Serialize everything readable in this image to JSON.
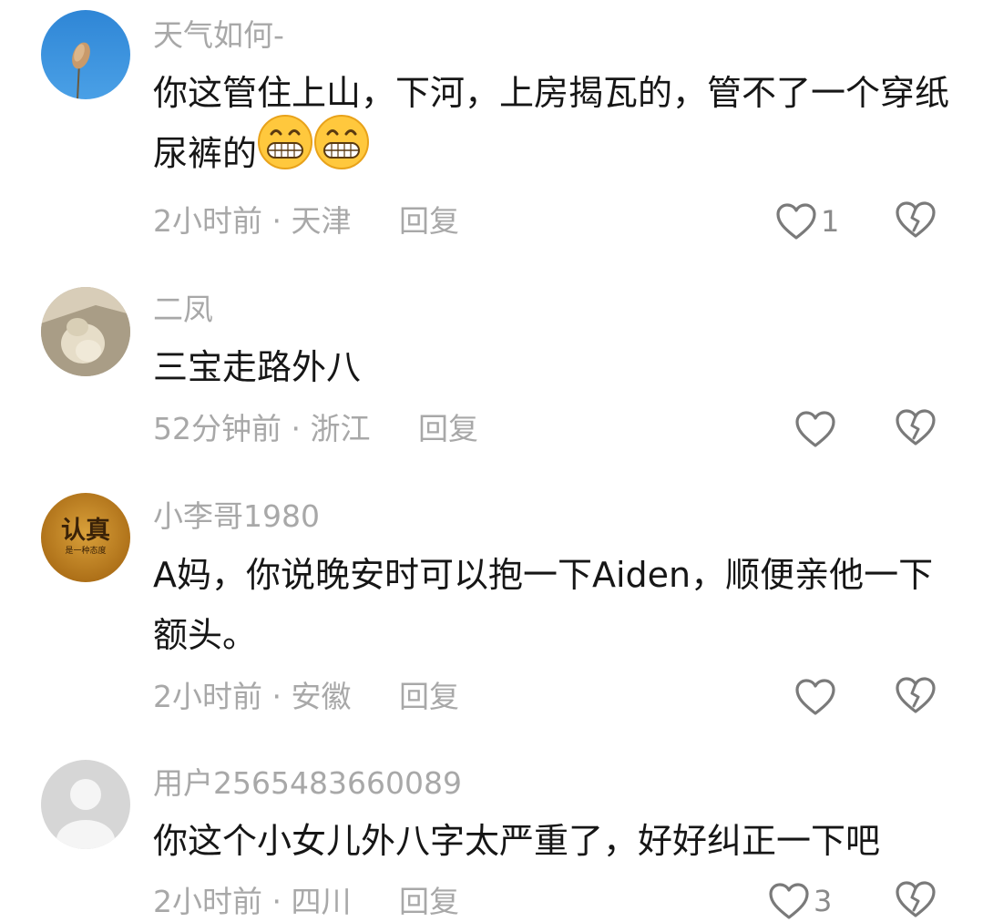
{
  "comments": [
    {
      "username": "天气如何-",
      "content": "你这管住上山，下河，上房揭瓦的，管不了一个穿纸尿裤的",
      "emojis": [
        "grin-emoji",
        "grin-emoji"
      ],
      "time": "2小时前",
      "location": "天津",
      "reply_label": "回复",
      "likes": "1",
      "avatar": "plant-on-blue-sky"
    },
    {
      "username": "二凤",
      "content": "三宝走路外八",
      "emojis": [],
      "time": "52分钟前",
      "location": "浙江",
      "reply_label": "回复",
      "likes": "",
      "avatar": "cat-in-box-photo"
    },
    {
      "username": "小李哥1980",
      "content": "A妈，你说晚安时可以抱一下Aiden，顺便亲他一下额头。",
      "emojis": [],
      "time": "2小时前",
      "location": "安徽",
      "reply_label": "回复",
      "likes": "",
      "avatar": "text-badge",
      "avatar_text": "认真",
      "avatar_subtext": "是一种态度"
    },
    {
      "username": "用户2565483660089",
      "content": "你这个小女儿外八字太严重了，好好纠正一下吧",
      "emojis": [],
      "time": "2小时前",
      "location": "四川",
      "reply_label": "回复",
      "likes": "3",
      "avatar": "default-user"
    }
  ],
  "separator": "·",
  "colors": {
    "text": "#161616",
    "muted": "#a8a8a8",
    "icon": "#7a7a7a"
  }
}
